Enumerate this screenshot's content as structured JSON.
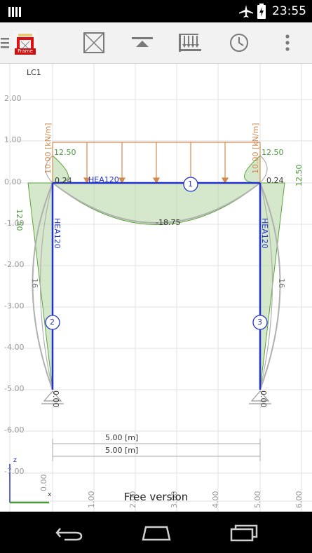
{
  "status_bar": {
    "time": "23:55",
    "icons": [
      "signal-bars-icon",
      "airplane-icon",
      "battery-charging-icon"
    ]
  },
  "toolbar": {
    "app_icon_label": "Frame",
    "buttons": [
      "menu-icon",
      "frame-icon",
      "support-icon",
      "loads-icon",
      "history-icon",
      "overflow-icon"
    ]
  },
  "load_case": "LC1",
  "y_ticks": [
    "2.00",
    "1.00",
    "0.00",
    "-1.00",
    "-2.00",
    "-3.00",
    "-4.00",
    "-5.00",
    "-6.00",
    "-7.00",
    "-1.00"
  ],
  "x_ticks": [
    "0.00",
    "1.00",
    "2.00",
    "3.00",
    "4.00",
    "5.00",
    "6.00"
  ],
  "labels": {
    "load_left": "10.00 [kN/m]",
    "load_right": "10.00 [kN/m]",
    "moment_left_top": "12.50",
    "moment_right_top": "12.50",
    "moment_left_side": "12.50",
    "moment_right_side": "12.50",
    "beam_section": "HEA120",
    "col_left_section": "HEA120",
    "col_right_section": "HEA120",
    "node_left_top": "0.24",
    "node_right_top": "0.24",
    "midspan": "-18.75",
    "defl_left": "16",
    "defl_right": "16",
    "support_left": "0.00",
    "support_right": "0.00",
    "member_1": "1",
    "member_2": "2",
    "member_3": "3",
    "dim_1": "5.00 [m]",
    "dim_2": "5.00 [m]",
    "axis_z": "z",
    "axis_x": "x"
  },
  "footer": {
    "free_version": "Free version"
  },
  "colors": {
    "frame": "#2233cc",
    "load": "#d08a50",
    "moment": "#5aa33a",
    "moment_fill": "#b9d9a8",
    "deflection": "#b0b0b0",
    "grid": "#e2e2e2"
  }
}
